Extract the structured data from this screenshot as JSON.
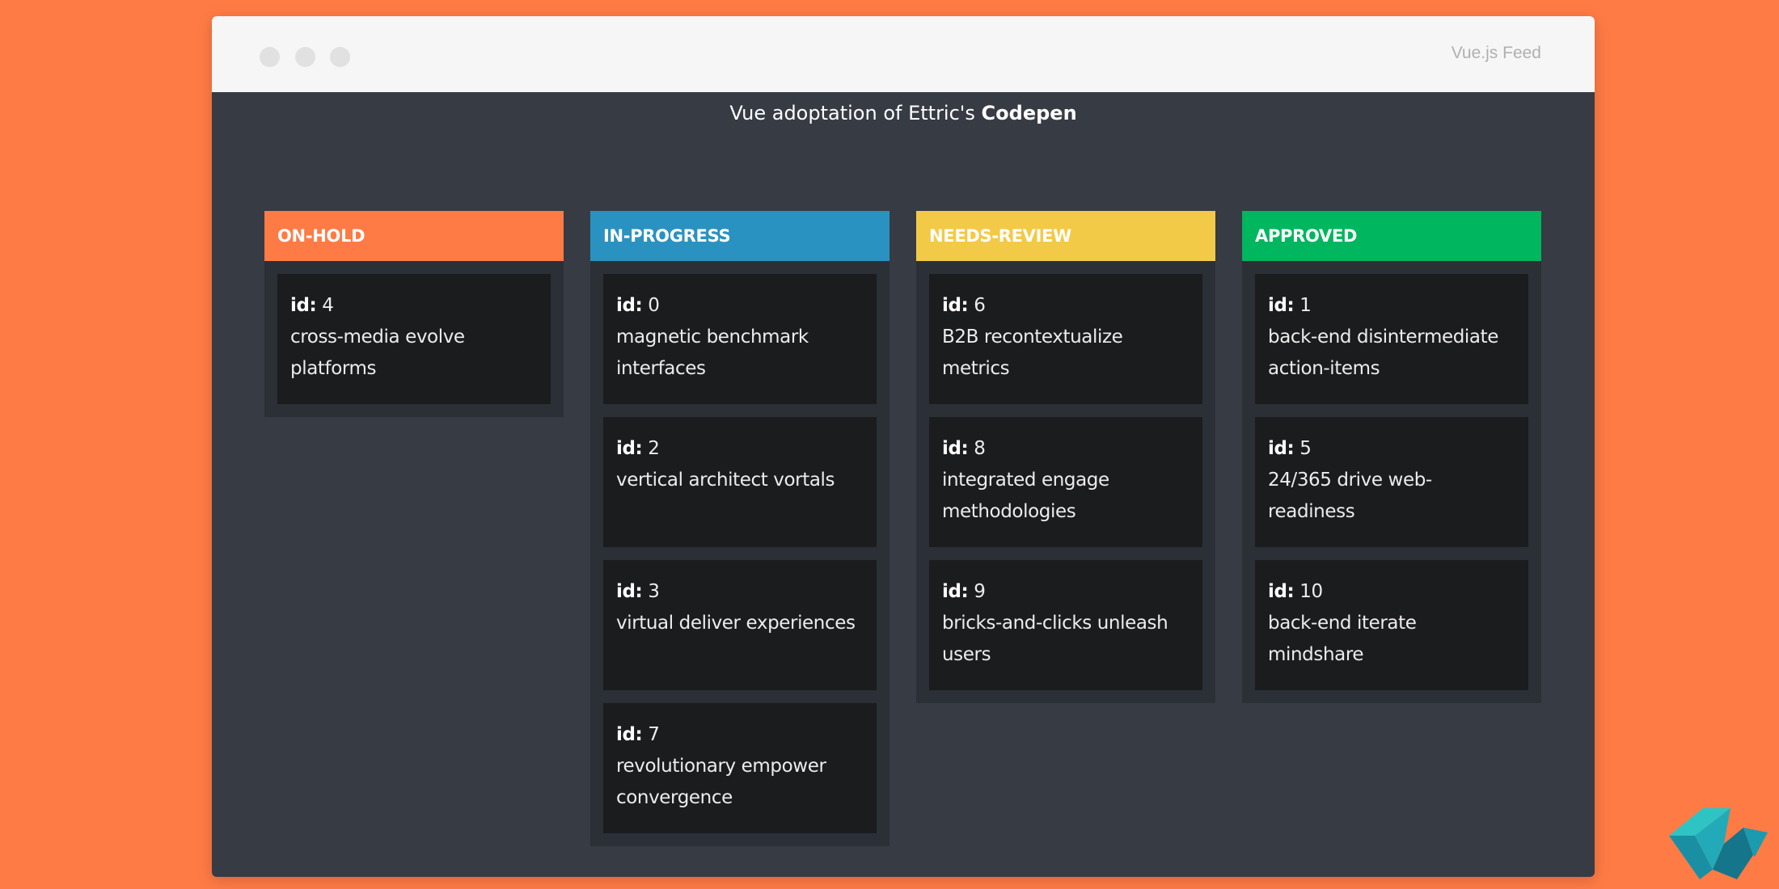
{
  "window": {
    "app_title": "Vue.js Feed",
    "heading_prefix": "Vue adoptation of Ettric's",
    "heading_link": "Codepen"
  },
  "columns": [
    {
      "title": "ON-HOLD",
      "color": "#ff7b45",
      "cards": [
        {
          "id_label": "id:",
          "id": "4",
          "text": "cross-media evolve platforms"
        }
      ]
    },
    {
      "title": "IN-PROGRESS",
      "color": "#2a92c0",
      "cards": [
        {
          "id_label": "id:",
          "id": "0",
          "text": "magnetic benchmark interfaces"
        },
        {
          "id_label": "id:",
          "id": "2",
          "text": "vertical architect vortals"
        },
        {
          "id_label": "id:",
          "id": "3",
          "text": "virtual deliver experiences"
        },
        {
          "id_label": "id:",
          "id": "7",
          "text": "revolutionary empower convergence"
        }
      ]
    },
    {
      "title": "NEEDS-REVIEW",
      "color": "#f3ca47",
      "cards": [
        {
          "id_label": "id:",
          "id": "6",
          "text": "B2B recontextualize metrics"
        },
        {
          "id_label": "id:",
          "id": "8",
          "text": "integrated engage methodologies"
        },
        {
          "id_label": "id:",
          "id": "9",
          "text": "bricks-and-clicks unleash users"
        }
      ]
    },
    {
      "title": "APPROVED",
      "color": "#00b65e",
      "cards": [
        {
          "id_label": "id:",
          "id": "1",
          "text": "back-end disintermediate action-items"
        },
        {
          "id_label": "id:",
          "id": "5",
          "text": "24/365 drive web-readiness"
        },
        {
          "id_label": "id:",
          "id": "10",
          "text": "back-end iterate mindshare"
        }
      ]
    }
  ],
  "icons": {
    "window_controls": [
      "window-dot-icon",
      "window-dot-icon",
      "window-dot-icon"
    ],
    "brand": "vue-feed-logo-icon"
  }
}
